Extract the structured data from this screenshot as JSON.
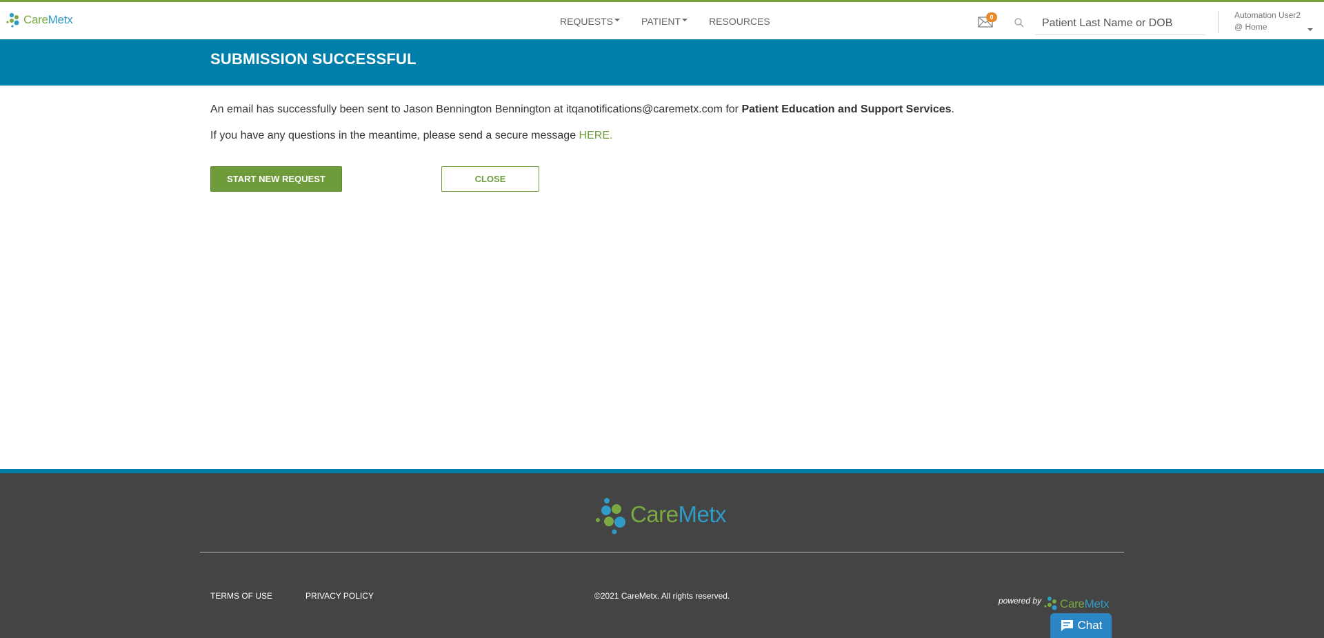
{
  "header": {
    "logo": {
      "care": "Care",
      "metx": "Metx"
    },
    "nav": [
      {
        "label": "REQUESTS",
        "has_dropdown": true
      },
      {
        "label": "PATIENT",
        "has_dropdown": true
      },
      {
        "label": "RESOURCES",
        "has_dropdown": false
      }
    ],
    "mail_badge": "0",
    "search_placeholder": "Patient Last Name or DOB",
    "user_name": "Automation User2",
    "user_location": "@ Home"
  },
  "banner": {
    "title": "SUBMISSION SUCCESSFUL"
  },
  "main": {
    "message1_prefix": "An email has successfully been sent to Jason Bennington Bennington at itqanotifications@caremetx.com for ",
    "message1_bold": "Patient Education and Support Services",
    "message1_suffix": ".",
    "message2_prefix": "If you have any questions in the meantime, please send a secure message ",
    "message2_link": "HERE.",
    "start_new_request": "START NEW REQUEST",
    "close": "CLOSE"
  },
  "footer": {
    "logo": {
      "care": "Care",
      "metx": "Metx"
    },
    "terms": "TERMS OF USE",
    "privacy": "PRIVACY POLICY",
    "copyright": "©2021 CareMetx. All rights reserved.",
    "powered_by": "powered by",
    "powered_logo": {
      "care": "Care",
      "metx": "Metx"
    }
  },
  "chat": {
    "label": "Chat"
  },
  "colors": {
    "accent_green": "#6f9c3b",
    "banner_blue": "#007fab",
    "footer_bg": "#444444",
    "badge_orange": "#e8892b",
    "chat_blue": "#2b86c5"
  }
}
